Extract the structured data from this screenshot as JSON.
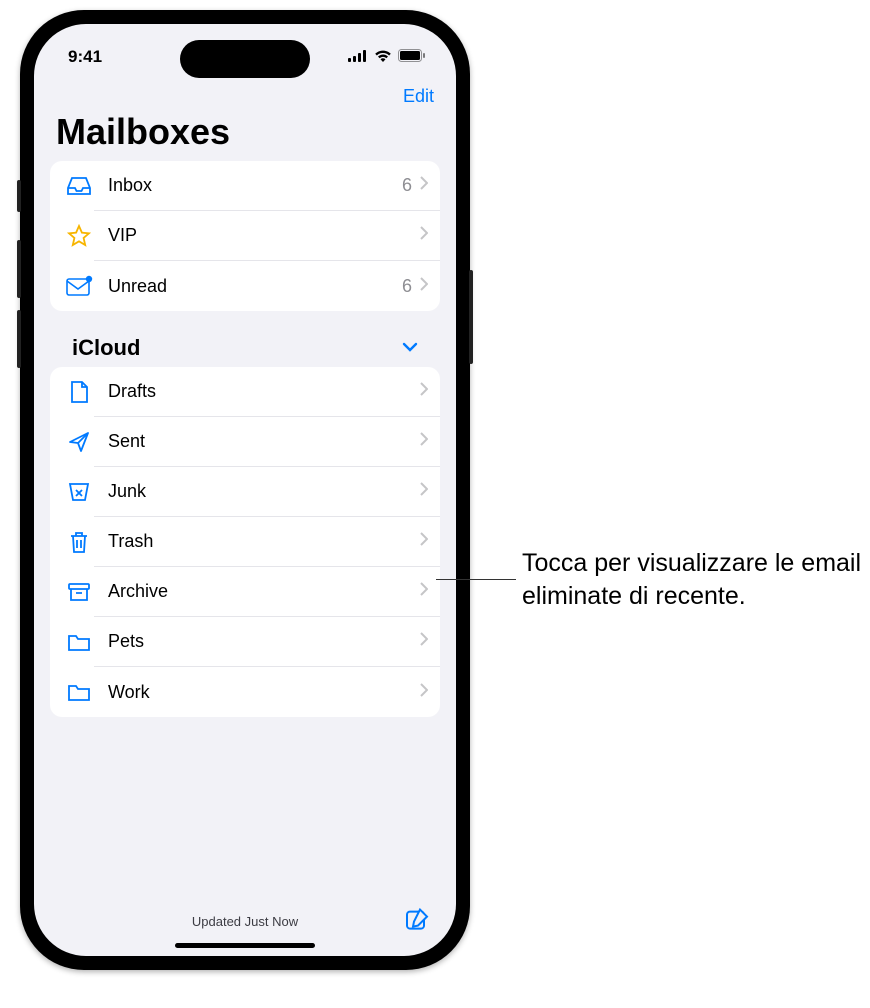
{
  "statusBar": {
    "time": "9:41"
  },
  "nav": {
    "edit": "Edit"
  },
  "title": "Mailboxes",
  "smart": [
    {
      "icon": "inbox",
      "label": "Inbox",
      "count": "6"
    },
    {
      "icon": "star",
      "label": "VIP",
      "count": ""
    },
    {
      "icon": "unread",
      "label": "Unread",
      "count": "6"
    }
  ],
  "account": {
    "name": "iCloud",
    "folders": [
      {
        "icon": "doc",
        "label": "Drafts"
      },
      {
        "icon": "send",
        "label": "Sent"
      },
      {
        "icon": "junk",
        "label": "Junk"
      },
      {
        "icon": "trash",
        "label": "Trash"
      },
      {
        "icon": "archive",
        "label": "Archive"
      },
      {
        "icon": "folder",
        "label": "Pets"
      },
      {
        "icon": "folder",
        "label": "Work"
      }
    ]
  },
  "toolbar": {
    "status": "Updated Just Now"
  },
  "callout": {
    "text": "Tocca per visualizzare le email eliminate di recente."
  }
}
